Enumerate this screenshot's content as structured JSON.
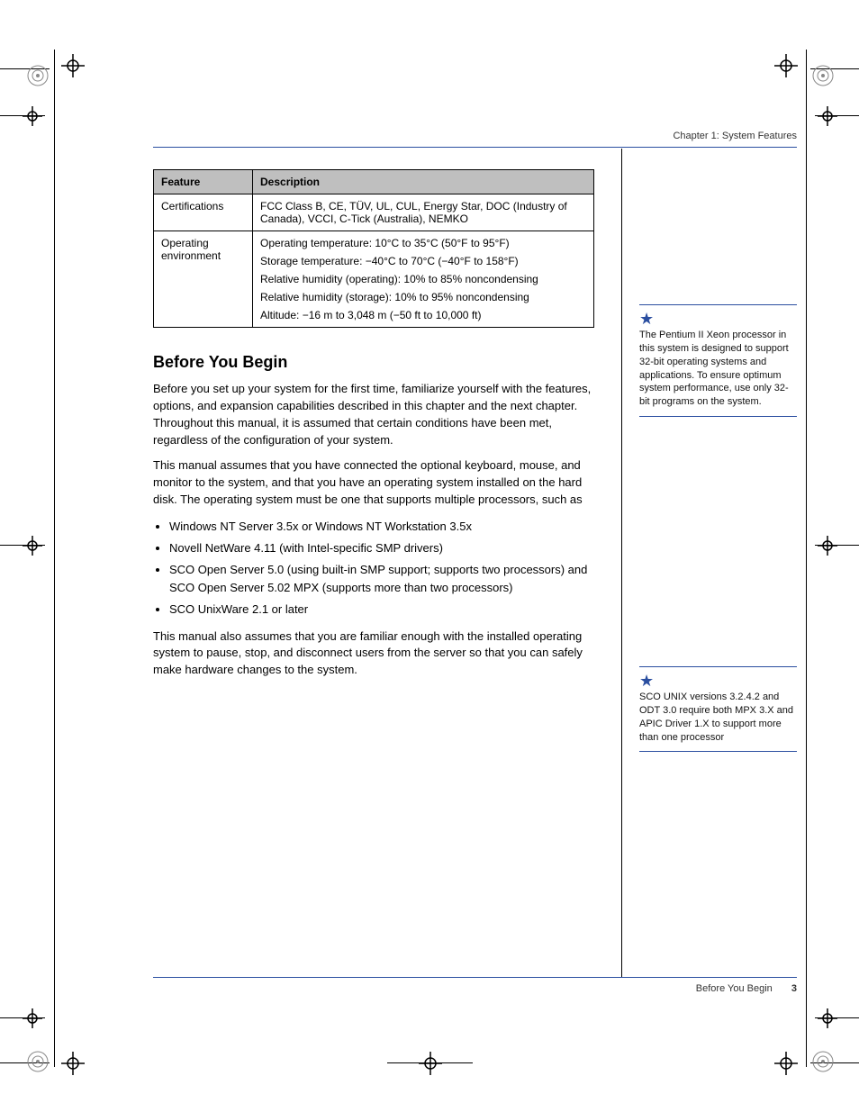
{
  "header": "Chapter 1: System Features",
  "table": {
    "head": {
      "c1": "Feature",
      "c2": "Description"
    },
    "rows": [
      {
        "c1": "Certifications",
        "c2": "FCC Class B, CE, TÜV, UL, CUL, Energy Star, DOC (Industry of Canada), VCCI, C-Tick (Australia), NEMKO"
      },
      {
        "c1": "Operating environment",
        "c2a": "Operating temperature: 10°C to 35°C (50°F to 95°F)",
        "c2b": "Storage temperature: −40°C to 70°C (−40°F to 158°F)",
        "c2c": "Relative humidity (operating): 10% to 85% noncondensing",
        "c2d": "Relative humidity (storage): 10% to 95% noncondensing",
        "c2e": "Altitude: −16 m to 3,048 m (−50 ft to 10,000 ft)"
      }
    ]
  },
  "section": {
    "title": "Before You Begin",
    "p1": "Before you set up your system for the first time, familiarize yourself with the features, options, and expansion capabilities described in this chapter and the next chapter. Throughout this manual, it is assumed that certain conditions have been met, regardless of the configuration of your system.",
    "p2": "This manual assumes that you have connected the optional keyboard, mouse, and monitor to the system, and that you have an operating system installed on the hard disk. The operating system must be one that supports multiple processors, such as",
    "os_list": [
      "Windows NT Server 3.5x or Windows NT Workstation 3.5x",
      "Novell NetWare 4.11 (with Intel-specific SMP drivers)",
      "SCO Open Server 5.0 (using built-in SMP support; supports two processors) and SCO Open Server 5.02 MPX (supports more than two processors)",
      "SCO UnixWare 2.1 or later"
    ],
    "p3": "This manual also assumes that you are familiar enough with the installed operating system to pause, stop, and disconnect users from the server so that you can safely make hardware changes to the system."
  },
  "notes": {
    "n1": "The Pentium II Xeon processor in this system is designed to support 32-bit operating systems and applications. To ensure optimum system performance, use only 32-bit programs on the system.",
    "n2": "SCO UNIX versions 3.2.4.2 and ODT 3.0 require both MPX 3.X and APIC Driver 1.X to support more than one processor"
  },
  "footer": {
    "label": "Before You Begin",
    "page": "3"
  }
}
